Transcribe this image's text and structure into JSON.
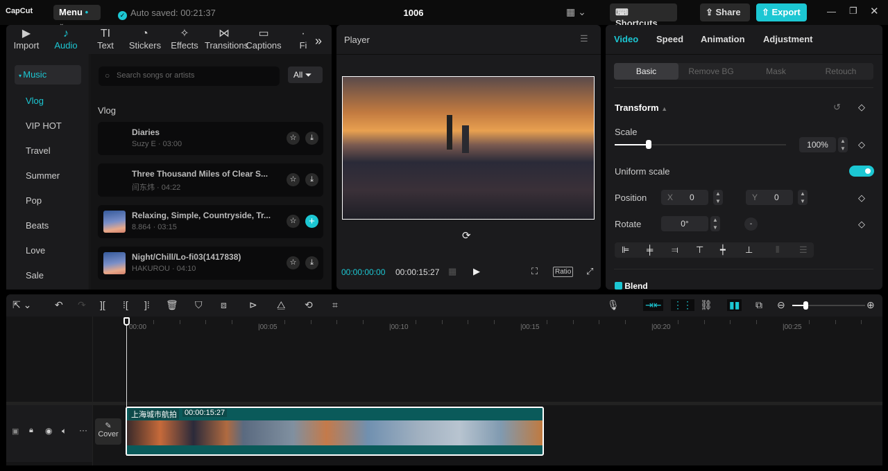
{
  "app": {
    "logo": "CapCut",
    "menu": "Menu",
    "autosave": "Auto saved: 00:21:37",
    "title": "1006",
    "shortcuts": "Shortcuts",
    "share": "Share",
    "export": "Export"
  },
  "left": {
    "tabs": [
      {
        "label": "Import",
        "icon": "▶"
      },
      {
        "label": "Audio",
        "icon": "♪"
      },
      {
        "label": "Text",
        "icon": "TI"
      },
      {
        "label": "Stickers",
        "icon": "◔"
      },
      {
        "label": "Effects",
        "icon": "✧"
      },
      {
        "label": "Transitions",
        "icon": "⋈"
      },
      {
        "label": "Captions",
        "icon": "▭"
      },
      {
        "label": "Fi",
        "icon": "·"
      }
    ],
    "categories": [
      "Music",
      "Vlog",
      "VIP HOT",
      "Travel",
      "Summer",
      "Pop",
      "Beats",
      "Love",
      "Sale"
    ],
    "search_placeholder": "Search songs or artists",
    "filter": "All",
    "section": "Vlog",
    "songs": [
      {
        "title": "Diaries",
        "sub": "Suzy E · 03:00"
      },
      {
        "title": "Three Thousand Miles of Clear S...",
        "sub": "闫东炜 · 04:22"
      },
      {
        "title": "Relaxing, Simple, Countryside, Tr...",
        "sub": "8.864 · 03:15"
      },
      {
        "title": "Night/Chill/Lo-fi03(1417838)",
        "sub": "HAKUROU · 04:10"
      }
    ]
  },
  "player": {
    "title": "Player",
    "current": "00:00:00:00",
    "total": "00:00:15:27",
    "ratio": "Ratio"
  },
  "right": {
    "tabs": [
      "Video",
      "Speed",
      "Animation",
      "Adjustment"
    ],
    "subtabs": [
      "Basic",
      "Remove BG",
      "Mask",
      "Retouch"
    ],
    "transform": "Transform",
    "scale_label": "Scale",
    "scale": "100%",
    "scale_fraction": 0.2,
    "uniform": "Uniform scale",
    "uniform_on": true,
    "position": "Position",
    "x_label": "X",
    "x": "0",
    "y_label": "Y",
    "y": "0",
    "rotate": "Rotate",
    "rotate_val": "0°",
    "blend": "Blend"
  },
  "timeline": {
    "ticks": [
      "00:00",
      "|00:05",
      "|00:10",
      "|00:15",
      "|00:20",
      "|00:25"
    ],
    "clip_name": "上海城市航拍",
    "clip_duration": "00:00:15:27",
    "cover": "Cover"
  },
  "colors": {
    "accent": "#1cc7d3"
  }
}
